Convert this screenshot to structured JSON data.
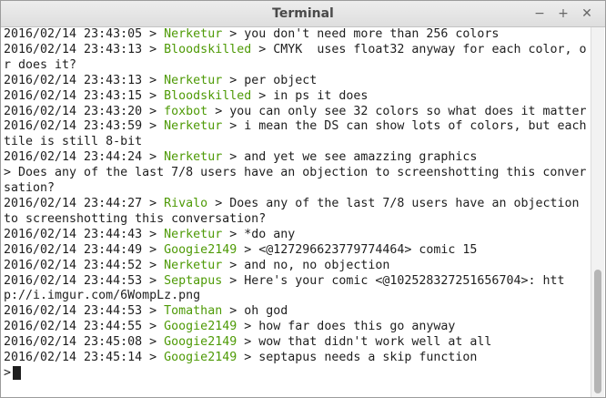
{
  "window": {
    "title": "Terminal",
    "controls": {
      "minimize": "−",
      "maximize": "+",
      "close": "✕"
    }
  },
  "lines": [
    {
      "time": "2016/02/14 23:43:05",
      "nick": "Nerketur",
      "msg": "you don't need more than 256 colors"
    },
    {
      "time": "2016/02/14 23:43:13",
      "nick": "Bloodskilled",
      "msg": "CMYK  uses float32 anyway for each color, or does it?"
    },
    {
      "time": "2016/02/14 23:43:13",
      "nick": "Nerketur",
      "msg": "per object"
    },
    {
      "time": "2016/02/14 23:43:15",
      "nick": "Bloodskilled",
      "msg": "in ps it does"
    },
    {
      "time": "2016/02/14 23:43:20",
      "nick": "foxbot",
      "msg": "you can only see 32 colors so what does it matter"
    },
    {
      "time": "2016/02/14 23:43:59",
      "nick": "Nerketur",
      "msg": "i mean the DS can show lots of colors, but each tile is still 8-bit"
    },
    {
      "time": "2016/02/14 23:44:24",
      "nick": "Nerketur",
      "msg": "and yet we see amazzing graphics"
    },
    {
      "raw": "> Does any of the last 7/8 users have an objection to screenshotting this conversation?"
    },
    {
      "time": "2016/02/14 23:44:27",
      "nick": "Rivalo",
      "msg": "Does any of the last 7/8 users have an objection to screenshotting this conversation?"
    },
    {
      "time": "2016/02/14 23:44:43",
      "nick": "Nerketur",
      "msg": "*do any"
    },
    {
      "time": "2016/02/14 23:44:49",
      "nick": "Googie2149",
      "msg": "<@127296623779774464> comic 15"
    },
    {
      "time": "2016/02/14 23:44:52",
      "nick": "Nerketur",
      "msg": "and no, no objection"
    },
    {
      "time": "2016/02/14 23:44:53",
      "nick": "Septapus",
      "msg": "Here's your comic <@102528327251656704>: http://i.imgur.com/6WompLz.png"
    },
    {
      "time": "2016/02/14 23:44:53",
      "nick": "Tomathan",
      "msg": "oh god"
    },
    {
      "time": "2016/02/14 23:44:55",
      "nick": "Googie2149",
      "msg": "how far does this go anyway"
    },
    {
      "time": "2016/02/14 23:45:08",
      "nick": "Googie2149",
      "msg": "wow that didn't work well at all"
    },
    {
      "time": "2016/02/14 23:45:14",
      "nick": "Googie2149",
      "msg": "septapus needs a skip function"
    }
  ],
  "prompt": {
    "symbol": ">"
  },
  "colors": {
    "nick": "#4e9a06",
    "text": "#1e1e1e",
    "background": "#ffffff"
  }
}
